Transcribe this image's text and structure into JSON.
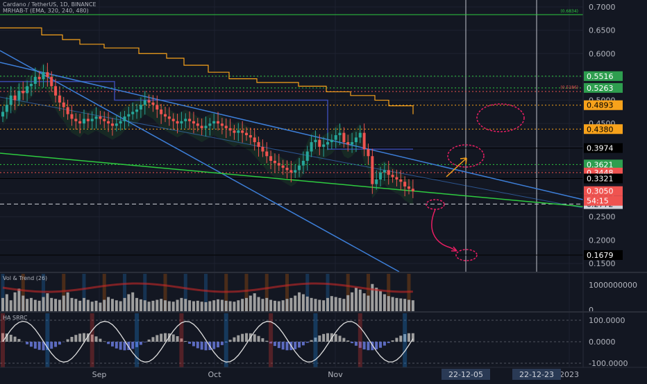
{
  "header": {
    "symbol": "Cardano / TetherUS, 1D, BINANCE",
    "indicator": "MRHAB-T (EMA, 320, 240, 480)"
  },
  "indicators": {
    "vol_trend": "Vol & Trend (26)",
    "ha_srrc": "HA SRRC"
  },
  "colors": {
    "background": "#131722",
    "grid": "#1e2230",
    "text": "#b2b5be",
    "bull": "#26a69a",
    "bear": "#ef5350",
    "trendline_blue": "#3d7fd9",
    "trendline_green": "#2ecc40",
    "orange": "#f7a21b",
    "pink": "#e91e63",
    "white": "#d1d4dc"
  },
  "chart_data": [
    {
      "type": "candlestick",
      "name": "price",
      "ylim": [
        0.13,
        0.72
      ],
      "ticks": [
        0.7,
        0.65,
        0.6,
        0.55,
        0.5,
        0.45,
        0.4,
        0.35,
        0.3,
        0.25,
        0.2,
        0.15
      ],
      "tick_labels": [
        "0.7000",
        "0.6500",
        "0.6000",
        "0.5500",
        "0.5000",
        "0.4500",
        "0.4000",
        "0.3500",
        "0.3000",
        "0.2500",
        "0.2000",
        "0.1500"
      ],
      "x_labels": [
        "Sep",
        "Oct",
        "Nov",
        "2023"
      ],
      "date_badges": [
        "22-12-05",
        "22-12-23"
      ],
      "close": [
        0.475,
        0.49,
        0.51,
        0.5,
        0.52,
        0.515,
        0.53,
        0.535,
        0.55,
        0.545,
        0.56,
        0.55,
        0.53,
        0.51,
        0.495,
        0.485,
        0.47,
        0.46,
        0.455,
        0.45,
        0.46,
        0.455,
        0.46,
        0.465,
        0.46,
        0.455,
        0.45,
        0.445,
        0.45,
        0.455,
        0.465,
        0.47,
        0.475,
        0.48,
        0.49,
        0.5,
        0.495,
        0.49,
        0.48,
        0.47,
        0.465,
        0.46,
        0.455,
        0.45,
        0.455,
        0.46,
        0.455,
        0.45,
        0.445,
        0.44,
        0.445,
        0.45,
        0.455,
        0.45,
        0.445,
        0.44,
        0.435,
        0.43,
        0.435,
        0.43,
        0.425,
        0.42,
        0.41,
        0.4,
        0.39,
        0.38,
        0.37,
        0.365,
        0.36,
        0.355,
        0.35,
        0.345,
        0.35,
        0.36,
        0.37,
        0.39,
        0.41,
        0.415,
        0.4,
        0.405,
        0.41,
        0.415,
        0.425,
        0.43,
        0.41,
        0.405,
        0.41,
        0.42,
        0.43,
        0.395,
        0.38,
        0.32,
        0.33,
        0.345,
        0.35,
        0.34,
        0.335,
        0.33,
        0.325,
        0.315,
        0.31,
        0.305
      ],
      "levels": [
        {
          "value": 0.6834,
          "label": "(0.6834)",
          "color": "#2ecc40",
          "style": "solid"
        },
        {
          "value": 0.5516,
          "label": "0.5516",
          "color": "#2ecc40",
          "style": "dotted"
        },
        {
          "value": 0.5263,
          "label": "0.5263",
          "color": "#2ecc40",
          "style": "dotted"
        },
        {
          "value": 0.5186,
          "label": "(0.5186)",
          "color": "#ef5350",
          "style": "dotted"
        },
        {
          "value": 0.4893,
          "label": "0.4893",
          "color": "#f7a21b",
          "style": "dotted"
        },
        {
          "value": 0.438,
          "label": "0.4380",
          "color": "#f7a21b",
          "style": "dotted"
        },
        {
          "value": 0.3974,
          "label": "0.3974",
          "color": "#000000",
          "style": "solid"
        },
        {
          "value": 0.3621,
          "label": "0.3621",
          "color": "#2ecc40",
          "style": "dotted"
        },
        {
          "value": 0.3448,
          "label": "0.3448",
          "color": "#ef5350",
          "style": "dotted"
        },
        {
          "value": 0.3321,
          "label": "0.3321",
          "color": "#000000",
          "style": "solid"
        },
        {
          "value": 0.305,
          "label": "0.3050",
          "color": "#ef5350",
          "style": "none"
        },
        {
          "value": 0.2772,
          "label": "0.2772",
          "color": "#d1d4dc",
          "style": "dashed"
        },
        {
          "value": 0.1679,
          "label": "0.1679",
          "color": "#000000",
          "style": "solid"
        }
      ],
      "countdown": "54:15"
    },
    {
      "type": "bar",
      "name": "Vol & Trend (26)",
      "ylim": [
        0,
        1200000000
      ],
      "tick_labels": [
        "1000000000",
        "0"
      ],
      "values": [
        300,
        380,
        250,
        420,
        500,
        350,
        280,
        300,
        260,
        240,
        320,
        400,
        300,
        280,
        260,
        350,
        420,
        300,
        280,
        240,
        300,
        260,
        220,
        240,
        200,
        260,
        320,
        280,
        250,
        230,
        300,
        380,
        420,
        300,
        270,
        250,
        220,
        240,
        260,
        280,
        250,
        230,
        220,
        260,
        300,
        280,
        250,
        230,
        240,
        220,
        210,
        230,
        250,
        270,
        260,
        240,
        230,
        220,
        250,
        280,
        300,
        350,
        400,
        320,
        280,
        300,
        260,
        240,
        230,
        250,
        280,
        300,
        350,
        420,
        380,
        330,
        300,
        280,
        260,
        250,
        300,
        340,
        320,
        300,
        280,
        360,
        420,
        520,
        480,
        400,
        350,
        600,
        520,
        450,
        380,
        340,
        320,
        300,
        290,
        280,
        260,
        250
      ]
    },
    {
      "type": "line",
      "name": "HA SRRC",
      "ylim": [
        -120,
        120
      ],
      "tick_labels": [
        "100.0000",
        "0.0000",
        "-100.0000"
      ]
    }
  ]
}
